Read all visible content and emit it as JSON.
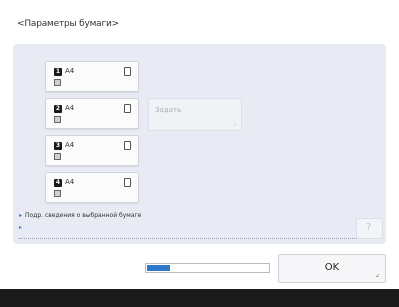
{
  "title": "<Параметры бумаги>",
  "drawers": [
    {
      "number": "1",
      "size": "A4"
    },
    {
      "number": "2",
      "size": "A4"
    },
    {
      "number": "3",
      "size": "A4"
    },
    {
      "number": "4",
      "size": "A4"
    }
  ],
  "set_button": {
    "label": "Задать",
    "corner": "⌟"
  },
  "info_link": {
    "bullet": "▸",
    "label": "Подр. сведения о выбранной бумаге"
  },
  "arrow_link": {
    "label": "▸"
  },
  "help_button": {
    "glyph": "?"
  },
  "progress": {
    "fraction": 0.2
  },
  "ok_button": {
    "label": "OK",
    "corner": "⌟"
  },
  "colors": {
    "accent": "#2f78c8",
    "panel": "#e8ebf3"
  }
}
